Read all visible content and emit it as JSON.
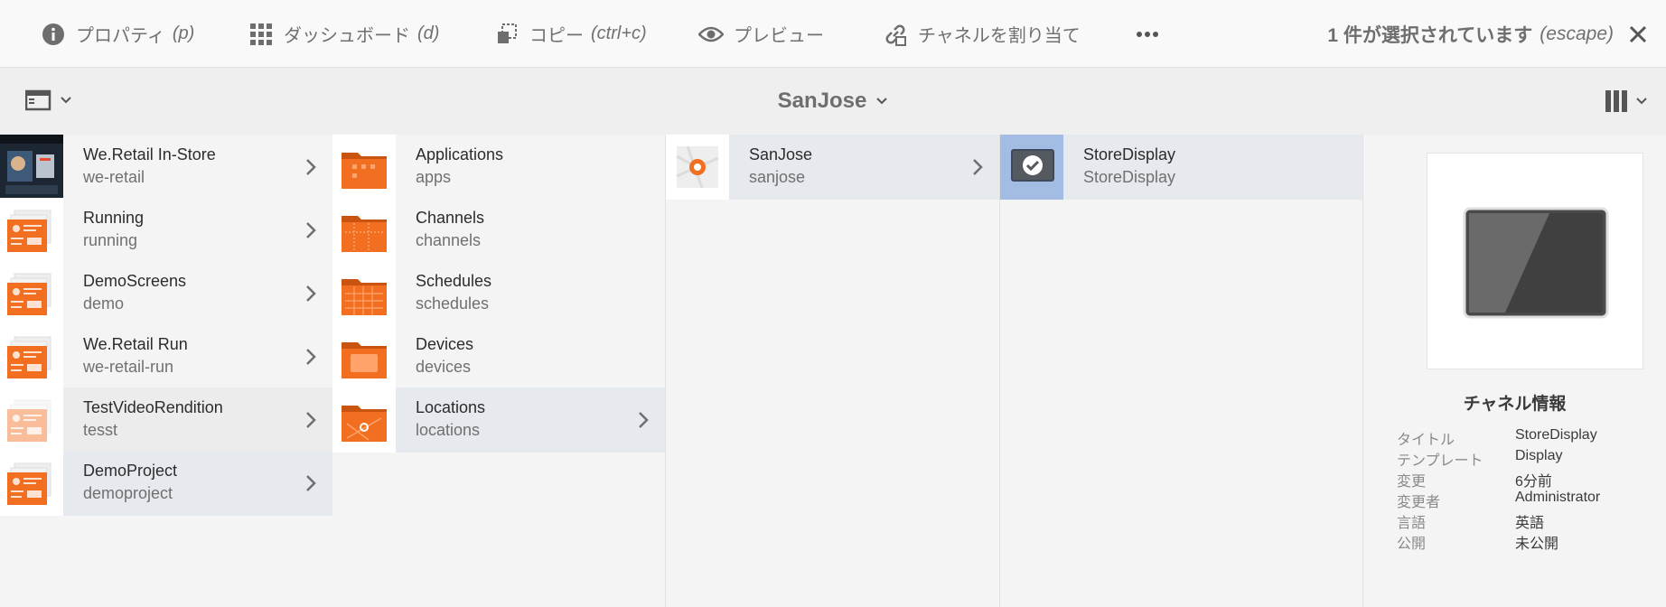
{
  "toolbar": {
    "properties": {
      "label": "プロパティ",
      "shortcut": "(p)"
    },
    "dashboard": {
      "label": "ダッシュボード",
      "shortcut": "(d)"
    },
    "copy": {
      "label": "コピー",
      "shortcut": "(ctrl+c)"
    },
    "preview": {
      "label": "プレビュー"
    },
    "assign_channel": {
      "label": "チャネルを割り当て"
    },
    "more_icon": "more-icon",
    "selection": {
      "text": "1 件が選択されています",
      "shortcut": "(escape)"
    }
  },
  "subbar": {
    "breadcrumb": "SanJose",
    "rail_icon": "rail-toggle-icon",
    "view_icon": "column-view-icon"
  },
  "columns": [
    {
      "items": [
        {
          "title": "We.Retail In-Store",
          "name": "we-retail",
          "thumb": "photo",
          "state": ""
        },
        {
          "title": "Running",
          "name": "running",
          "thumb": "project",
          "state": ""
        },
        {
          "title": "DemoScreens",
          "name": "demo",
          "thumb": "project",
          "state": ""
        },
        {
          "title": "We.Retail Run",
          "name": "we-retail-run",
          "thumb": "project",
          "state": ""
        },
        {
          "title": "TestVideoRendition",
          "name": "tesst",
          "thumb": "project-faded",
          "state": "hover"
        },
        {
          "title": "DemoProject",
          "name": "demoproject",
          "thumb": "project",
          "state": "active"
        }
      ]
    },
    {
      "items": [
        {
          "title": "Applications",
          "name": "apps",
          "thumb": "folder-apps",
          "state": ""
        },
        {
          "title": "Channels",
          "name": "channels",
          "thumb": "folder-channels",
          "state": ""
        },
        {
          "title": "Schedules",
          "name": "schedules",
          "thumb": "folder-schedules",
          "state": ""
        },
        {
          "title": "Devices",
          "name": "devices",
          "thumb": "folder-devices",
          "state": ""
        },
        {
          "title": "Locations",
          "name": "locations",
          "thumb": "folder-locations",
          "state": "active"
        }
      ]
    },
    {
      "items": [
        {
          "title": "SanJose",
          "name": "sanjose",
          "thumb": "location",
          "state": "active"
        }
      ]
    },
    {
      "items": [
        {
          "title": "StoreDisplay",
          "name": "StoreDisplay",
          "thumb": "display-selected",
          "state": "active"
        }
      ]
    }
  ],
  "detail": {
    "title": "チャネル情報",
    "meta": [
      {
        "key": "タイトル",
        "value": "StoreDisplay"
      },
      {
        "key": "テンプレート",
        "value": "Display"
      },
      {
        "key": "変更",
        "value": "6分前"
      },
      {
        "key": "変更者",
        "value": "Administrator"
      },
      {
        "key": "言語",
        "value": "英語"
      },
      {
        "key": "公開",
        "value": "未公開"
      }
    ]
  },
  "colors": {
    "accent": "#f26f21",
    "selected": "#a3bce3",
    "active_row": "#e6e9ee"
  }
}
